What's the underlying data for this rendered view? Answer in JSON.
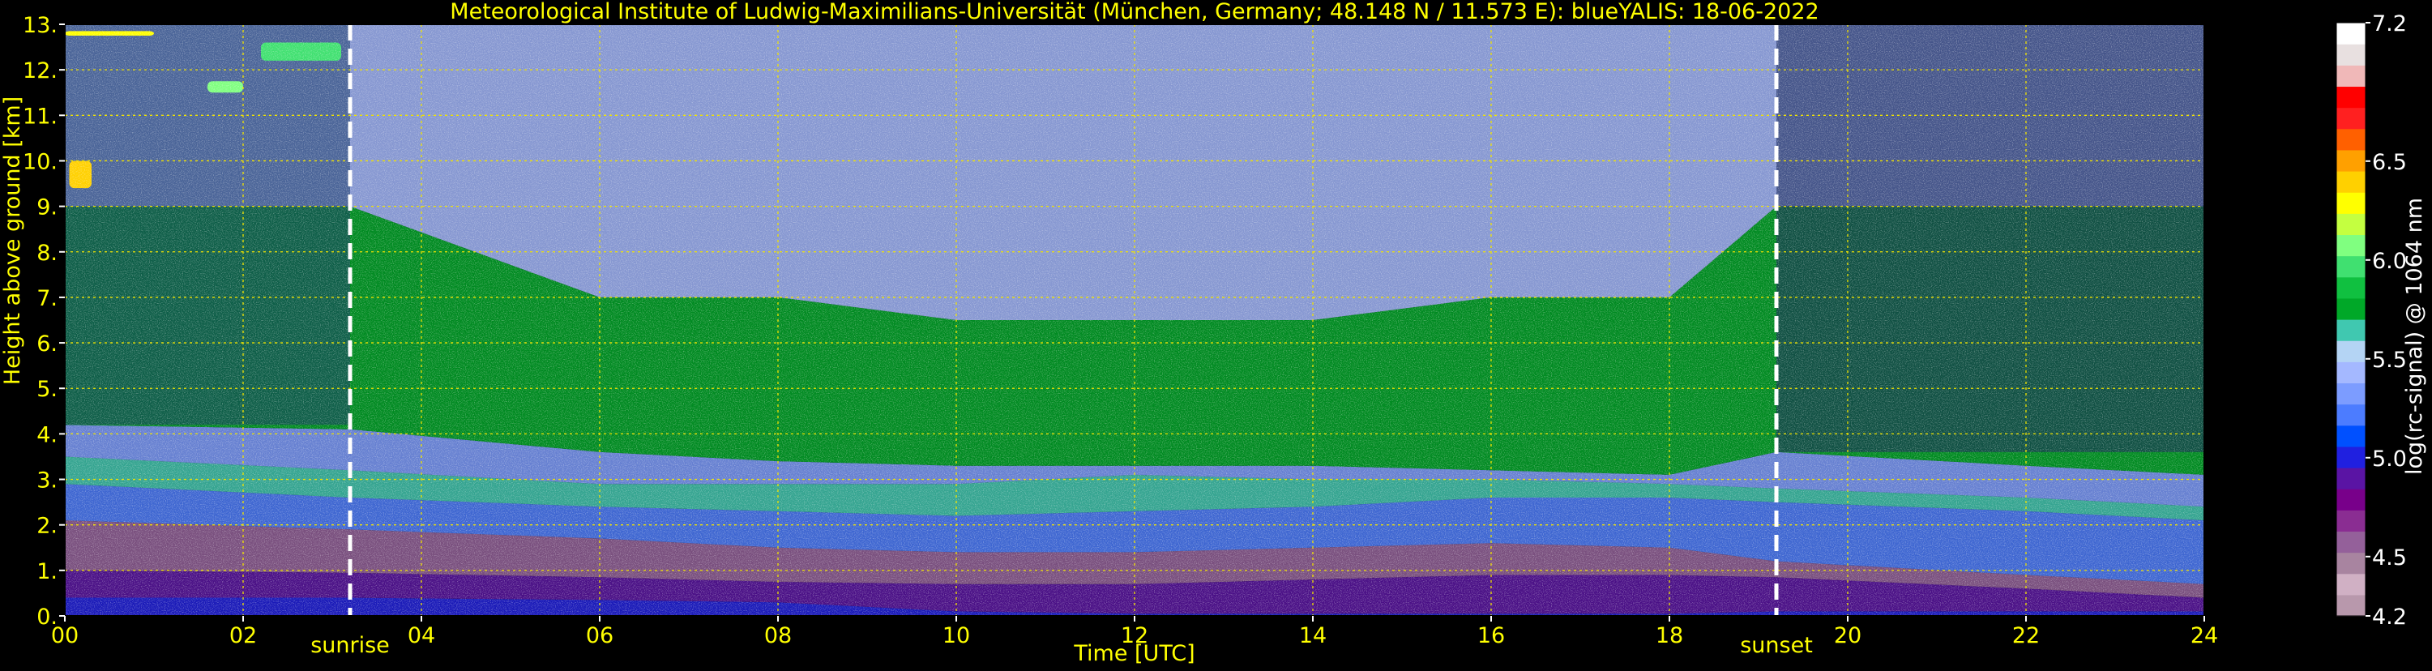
{
  "chart_data": {
    "type": "heatmap",
    "title": "Meteorological Institute of Ludwig-Maximilians-Universität (München, Germany; 48.148 N / 11.573 E):    blueYALIS: 18-06-2022",
    "xlabel": "Time [UTC]",
    "ylabel": "Height above ground [km]",
    "xlim": [
      0,
      24
    ],
    "ylim": [
      0,
      13
    ],
    "x_ticks": [
      0,
      2,
      4,
      6,
      8,
      10,
      12,
      14,
      16,
      18,
      20,
      22,
      24
    ],
    "x_tick_labels": [
      "00",
      "02",
      "04",
      "06",
      "08",
      "10",
      "12",
      "14",
      "16",
      "18",
      "20",
      "22",
      "24"
    ],
    "y_ticks": [
      0,
      1,
      2,
      3,
      4,
      5,
      6,
      7,
      8,
      9,
      10,
      11,
      12,
      13
    ],
    "y_tick_labels": [
      "0.",
      "1.",
      "2.",
      "3.",
      "4.",
      "5.",
      "6.",
      "7.",
      "8.",
      "9.",
      "10.",
      "11.",
      "12.",
      "13."
    ],
    "grid": true,
    "grid_color": "#f2e400",
    "text_color": "#ffff00",
    "background": "#000000",
    "events": [
      {
        "label": "sunrise",
        "x": 3.2
      },
      {
        "label": "sunset",
        "x": 19.2
      }
    ],
    "colorbar": {
      "label": "log(rc-signal) @ 1064 nm",
      "range": [
        4.2,
        7.2
      ],
      "tick_values": [
        7.2,
        6.5,
        6.0,
        5.5,
        5.0,
        4.5,
        4.2
      ],
      "tick_labels": [
        "7.2",
        "6.5",
        "6.0",
        "5.5",
        "5.0",
        "4.5",
        "4.2"
      ],
      "colors": [
        "#b898ac",
        "#d0b0c4",
        "#a884a0",
        "#94609a",
        "#8a2d92",
        "#78008a",
        "#5a14a4",
        "#2020e0",
        "#0050ff",
        "#4c7cff",
        "#7c9cff",
        "#a4b8ff",
        "#b4d4f4",
        "#40c8b0",
        "#00a828",
        "#10c040",
        "#40e070",
        "#80ff80",
        "#c4ff40",
        "#ffff00",
        "#ffd000",
        "#ffa000",
        "#ff6000",
        "#ff2020",
        "#ff0000",
        "#f0b8b8",
        "#e8e0e0",
        "#ffffff"
      ]
    },
    "layers": [
      {
        "x": [
          0,
          3.2,
          6,
          8,
          10,
          12,
          14,
          16,
          18,
          19.2,
          22,
          24
        ],
        "y_low": [
          0,
          0,
          0,
          0,
          0,
          0,
          0,
          0,
          0,
          0,
          0,
          0
        ],
        "y_high": [
          0.4,
          0.4,
          0.35,
          0.3,
          0.1,
          0.05,
          0.05,
          0.05,
          0.05,
          0.1,
          0.1,
          0.1
        ],
        "value": 5.05
      },
      {
        "x": [
          0,
          3.2,
          6,
          8,
          10,
          12,
          14,
          16,
          18,
          19.2,
          22,
          24
        ],
        "y_low": [
          0.4,
          0.4,
          0.35,
          0.3,
          0.1,
          0.05,
          0.05,
          0.05,
          0.05,
          0.1,
          0.1,
          0.1
        ],
        "y_high": [
          1.0,
          0.95,
          0.85,
          0.75,
          0.7,
          0.7,
          0.8,
          0.9,
          0.9,
          0.85,
          0.6,
          0.4
        ],
        "value": 4.85
      },
      {
        "x": [
          0,
          3.2,
          6,
          8,
          10,
          12,
          14,
          16,
          18,
          19.2,
          22,
          24
        ],
        "y_low": [
          1.0,
          0.95,
          0.85,
          0.75,
          0.7,
          0.7,
          0.8,
          0.9,
          0.9,
          0.85,
          0.6,
          0.4
        ],
        "y_high": [
          2.1,
          1.9,
          1.7,
          1.5,
          1.4,
          1.4,
          1.5,
          1.6,
          1.5,
          1.2,
          0.9,
          0.7
        ],
        "value": 4.55
      },
      {
        "x": [
          0,
          3.2,
          6,
          8,
          10,
          12,
          14,
          16,
          18,
          19.2,
          22,
          24
        ],
        "y_low": [
          2.1,
          1.9,
          1.7,
          1.5,
          1.4,
          1.4,
          1.5,
          1.6,
          1.5,
          1.2,
          0.9,
          0.7
        ],
        "y_high": [
          2.9,
          2.6,
          2.4,
          2.3,
          2.2,
          2.3,
          2.4,
          2.6,
          2.6,
          2.5,
          2.3,
          2.1
        ],
        "value": 5.2
      },
      {
        "x": [
          0,
          3.2,
          6,
          8,
          10,
          12,
          14,
          16,
          18,
          19.2,
          22,
          24
        ],
        "y_low": [
          2.9,
          2.6,
          2.4,
          2.3,
          2.2,
          2.3,
          2.4,
          2.6,
          2.6,
          2.5,
          2.3,
          2.1
        ],
        "y_high": [
          3.5,
          3.2,
          2.9,
          2.9,
          2.9,
          3.1,
          3.0,
          3.0,
          2.9,
          2.8,
          2.6,
          2.4
        ],
        "value": 5.6
      },
      {
        "x": [
          0,
          3.2,
          6,
          8,
          10,
          12,
          14,
          16,
          18,
          19.2,
          22,
          24
        ],
        "y_low": [
          3.5,
          3.2,
          2.9,
          2.9,
          2.9,
          3.1,
          3.0,
          3.0,
          2.9,
          2.8,
          2.6,
          2.4
        ],
        "y_high": [
          4.2,
          4.1,
          3.6,
          3.4,
          3.3,
          3.3,
          3.3,
          3.2,
          3.1,
          3.6,
          3.3,
          3.1
        ],
        "value": 5.3
      },
      {
        "x": [
          0,
          3.2,
          6,
          8,
          10,
          12,
          14,
          16,
          18,
          19.2,
          22,
          24
        ],
        "y_low": [
          4.2,
          4.1,
          3.6,
          3.4,
          3.3,
          3.3,
          3.3,
          3.2,
          3.1,
          3.6,
          3.3,
          3.1
        ],
        "y_high": [
          9.0,
          9.0,
          7.0,
          7.0,
          6.5,
          6.5,
          6.5,
          7.0,
          7.0,
          9.0,
          9.0,
          9.0
        ],
        "value": 5.7
      },
      {
        "x": [
          0,
          3.2,
          6,
          8,
          10,
          12,
          14,
          16,
          18,
          19.2,
          22,
          24
        ],
        "y_low": [
          9.0,
          9.0,
          7.0,
          7.0,
          6.5,
          6.5,
          6.5,
          7.0,
          7.0,
          9.0,
          9.0,
          9.0
        ],
        "y_high": [
          13,
          13,
          13,
          13,
          13,
          13,
          13,
          13,
          13,
          13,
          13,
          13
        ],
        "value": 5.4
      }
    ],
    "clouds": [
      {
        "x": [
          0.0,
          1.0
        ],
        "y": [
          12.75,
          12.85
        ],
        "value": 6.3
      },
      {
        "x": [
          1.6,
          2.0
        ],
        "y": [
          11.5,
          11.75
        ],
        "value": 6.1
      },
      {
        "x": [
          2.2,
          3.1
        ],
        "y": [
          12.2,
          12.6
        ],
        "value": 6.0
      },
      {
        "x": [
          0.05,
          0.3
        ],
        "y": [
          9.4,
          10.0
        ],
        "value": 6.4
      }
    ]
  }
}
